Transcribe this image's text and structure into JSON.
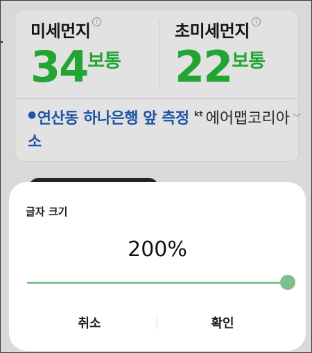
{
  "air_quality": {
    "fine_dust": {
      "label": "미세먼지",
      "value": "34",
      "grade": "보통",
      "info_icon": "info-icon"
    },
    "ultrafine_dust": {
      "label": "초미세먼지",
      "value": "22",
      "grade": "보통",
      "info_icon": "info-icon"
    },
    "station": "연산동 하나은행 앞 측정소",
    "provider_logo": "kt",
    "provider": "에어맵코리아"
  },
  "font_size_dialog": {
    "title": "글자 크기",
    "value_label": "200%",
    "level": 1.0,
    "cancel_label": "취소",
    "confirm_label": "확인"
  },
  "colors": {
    "good_green": "#22a533",
    "link_blue": "#1f53a8",
    "slider_green": "#7dbf8f"
  }
}
